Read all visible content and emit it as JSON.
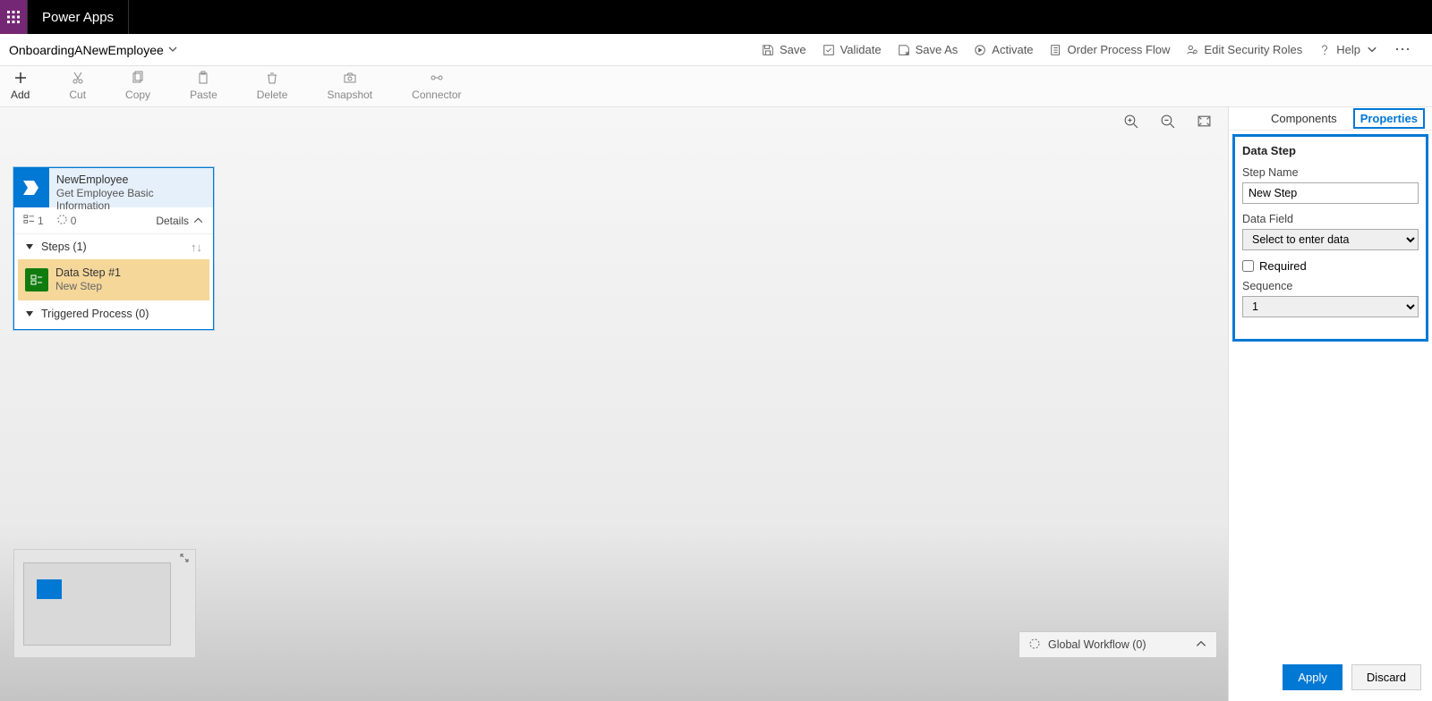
{
  "app": {
    "name": "Power Apps"
  },
  "breadcrumb": {
    "flowName": "OnboardingANewEmployee"
  },
  "header": {
    "save": "Save",
    "validate": "Validate",
    "saveAs": "Save As",
    "activate": "Activate",
    "orderProcessFlow": "Order Process Flow",
    "editSecurityRoles": "Edit Security Roles",
    "help": "Help"
  },
  "ribbon": {
    "add": "Add",
    "cut": "Cut",
    "copy": "Copy",
    "paste": "Paste",
    "delete": "Delete",
    "snapshot": "Snapshot",
    "connector": "Connector"
  },
  "stage": {
    "entity": "NewEmployee",
    "name": "Get Employee Basic Information",
    "count1": "1",
    "count2": "0",
    "detailsLabel": "Details",
    "stepsHeader": "Steps (1)",
    "step": {
      "title": "Data Step #1",
      "name": "New Step"
    },
    "triggered": "Triggered Process (0)"
  },
  "globalWorkflow": {
    "label": "Global Workflow (0)"
  },
  "rightPanel": {
    "tabs": {
      "components": "Components",
      "properties": "Properties"
    },
    "title": "Data Step",
    "stepNameLabel": "Step Name",
    "stepNameValue": "New Step",
    "dataFieldLabel": "Data Field",
    "dataFieldPlaceholder": "Select to enter data",
    "requiredLabel": "Required",
    "sequenceLabel": "Sequence",
    "sequenceValue": "1",
    "applyLabel": "Apply",
    "discardLabel": "Discard"
  }
}
